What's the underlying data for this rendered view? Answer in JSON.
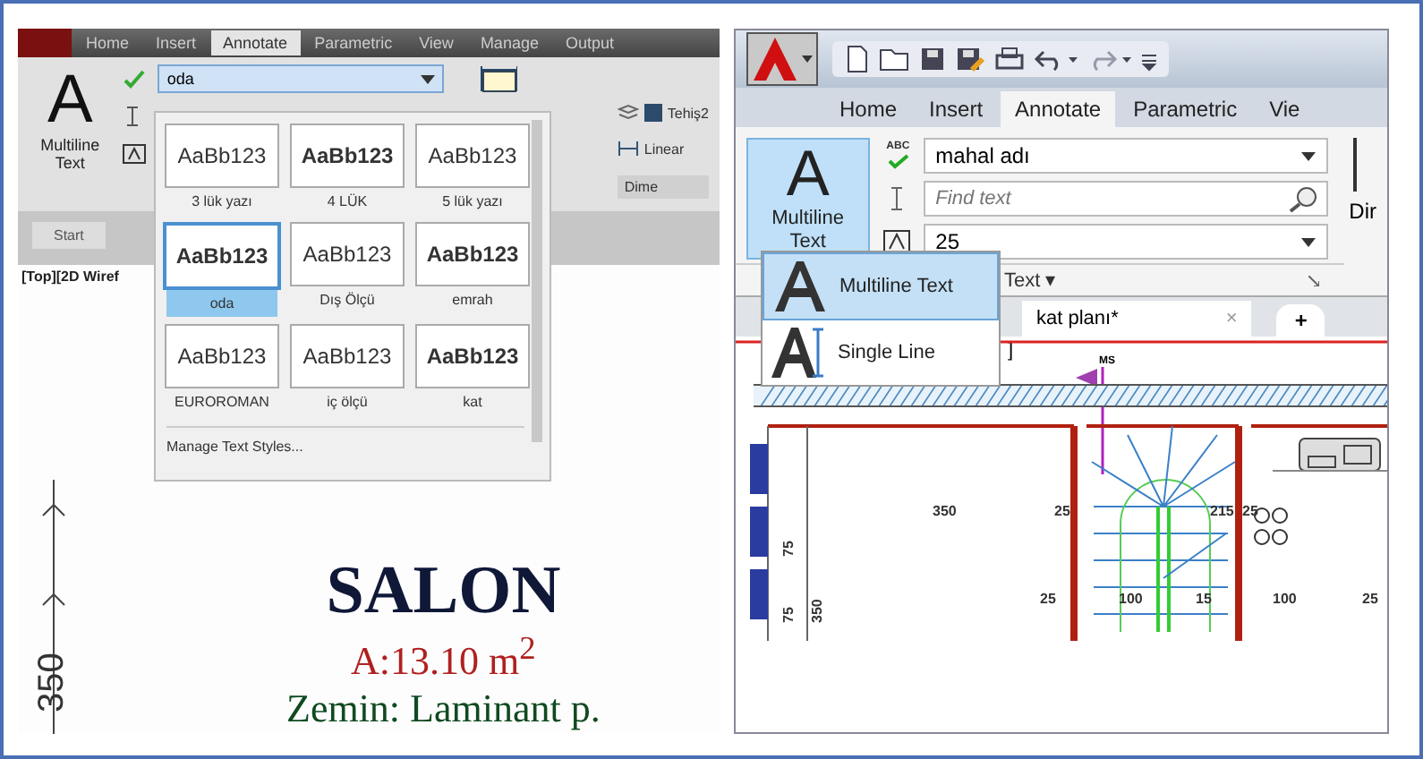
{
  "left": {
    "tabs": [
      {
        "label": "Home",
        "selected": false
      },
      {
        "label": "Insert",
        "selected": false
      },
      {
        "label": "Annotate",
        "selected": true
      },
      {
        "label": "Parametric",
        "selected": false
      },
      {
        "label": "View",
        "selected": false
      },
      {
        "label": "Manage",
        "selected": false
      },
      {
        "label": "Output",
        "selected": false
      }
    ],
    "multiline": {
      "glyph": "A",
      "label": "Multiline Text"
    },
    "style_dropdown": {
      "value": "oda"
    },
    "layer_label": "Tehiş2",
    "linear_label": "Linear",
    "panel_label": "Dime",
    "file_tab": "Start",
    "viewport_label": "[Top][2D Wiref",
    "styles": [
      {
        "sample": "AaBb123",
        "name": "3 lük yazı",
        "bold": false,
        "selected": false
      },
      {
        "sample": "AaBb123",
        "name": "4 LÜK",
        "bold": true,
        "selected": false
      },
      {
        "sample": "AaBb123",
        "name": "5 lük yazı",
        "bold": false,
        "selected": false
      },
      {
        "sample": "AaBb123",
        "name": "oda",
        "bold": true,
        "selected": true
      },
      {
        "sample": "AaBb123",
        "name": "Dış Ölçü",
        "bold": false,
        "selected": false
      },
      {
        "sample": "AaBb123",
        "name": "emrah",
        "bold": true,
        "selected": false
      },
      {
        "sample": "AaBb123",
        "name": "EUROROMAN",
        "bold": false,
        "selected": false
      },
      {
        "sample": "AaBb123",
        "name": "iç ölçü",
        "bold": false,
        "selected": false
      },
      {
        "sample": "AaBb123",
        "name": "kat",
        "bold": true,
        "selected": false
      }
    ],
    "manage_link": "Manage Text Styles...",
    "dimension": "350",
    "room": {
      "name": "SALON",
      "area": "A:13.10 m$^{2}$",
      "floor": "Zemin: Laminant p."
    }
  },
  "right": {
    "tabs": [
      {
        "label": "Home",
        "selected": false
      },
      {
        "label": "Insert",
        "selected": false
      },
      {
        "label": "Annotate",
        "selected": true
      },
      {
        "label": "Parametric",
        "selected": false
      },
      {
        "label": "Vie",
        "selected": false
      }
    ],
    "multiline": {
      "glyph": "A",
      "label": "Multiline Text"
    },
    "spell_label": "ABC",
    "style_field": {
      "value": "mahal adı"
    },
    "find_field": {
      "placeholder": "Find text"
    },
    "height_field": {
      "value": "25"
    },
    "cut_label": "Dir",
    "panel_label": "Text ▾",
    "menu": [
      {
        "label": "Multiline Text",
        "kind": "multiline",
        "selected": true
      },
      {
        "label": "Single Line",
        "kind": "single",
        "selected": false
      }
    ],
    "doc_tab": {
      "label": "kat planı*",
      "close": "×"
    },
    "new_tab": "+",
    "viewport_label": "]",
    "section_mark": "MS",
    "plan_labels": [
      "350",
      "25",
      "215",
      "25",
      "25",
      "100",
      "15",
      "100",
      "25",
      "75",
      "75",
      "350"
    ]
  }
}
